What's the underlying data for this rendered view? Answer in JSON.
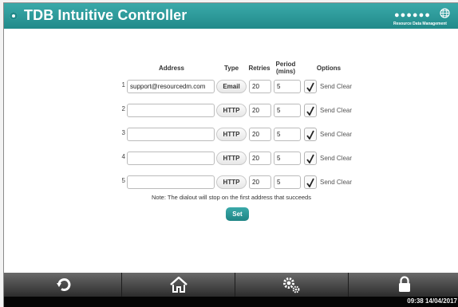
{
  "app": {
    "title": "TDB Intuitive Controller",
    "brand_dots": "●●●●●●",
    "brand_text": "Resource Data Management"
  },
  "table": {
    "headers": {
      "address": "Address",
      "type": "Type",
      "retries": "Retries",
      "period": "Period (mins)",
      "options": "Options"
    },
    "rows": [
      {
        "num": "1",
        "address": "support@resourcedm.com",
        "type": "Email",
        "retries": "20",
        "period": "5",
        "option": "Send Clear",
        "checked": true
      },
      {
        "num": "2",
        "address": "",
        "type": "HTTP",
        "retries": "20",
        "period": "5",
        "option": "Send Clear",
        "checked": true
      },
      {
        "num": "3",
        "address": "",
        "type": "HTTP",
        "retries": "20",
        "period": "5",
        "option": "Send Clear",
        "checked": true
      },
      {
        "num": "4",
        "address": "",
        "type": "HTTP",
        "retries": "20",
        "period": "5",
        "option": "Send Clear",
        "checked": true
      },
      {
        "num": "5",
        "address": "",
        "type": "HTTP",
        "retries": "20",
        "period": "5",
        "option": "Send Clear",
        "checked": true
      }
    ]
  },
  "note": "Note: The dialout will stop on the first address that succeeds",
  "set_label": "Set",
  "nav": {
    "items": [
      "back-icon",
      "home-icon",
      "settings-icon",
      "lock-icon"
    ]
  },
  "status": {
    "clock": "09:38 14/04/2017"
  },
  "colors": {
    "accent": "#2a9797",
    "bar": "#3a3a3a"
  }
}
